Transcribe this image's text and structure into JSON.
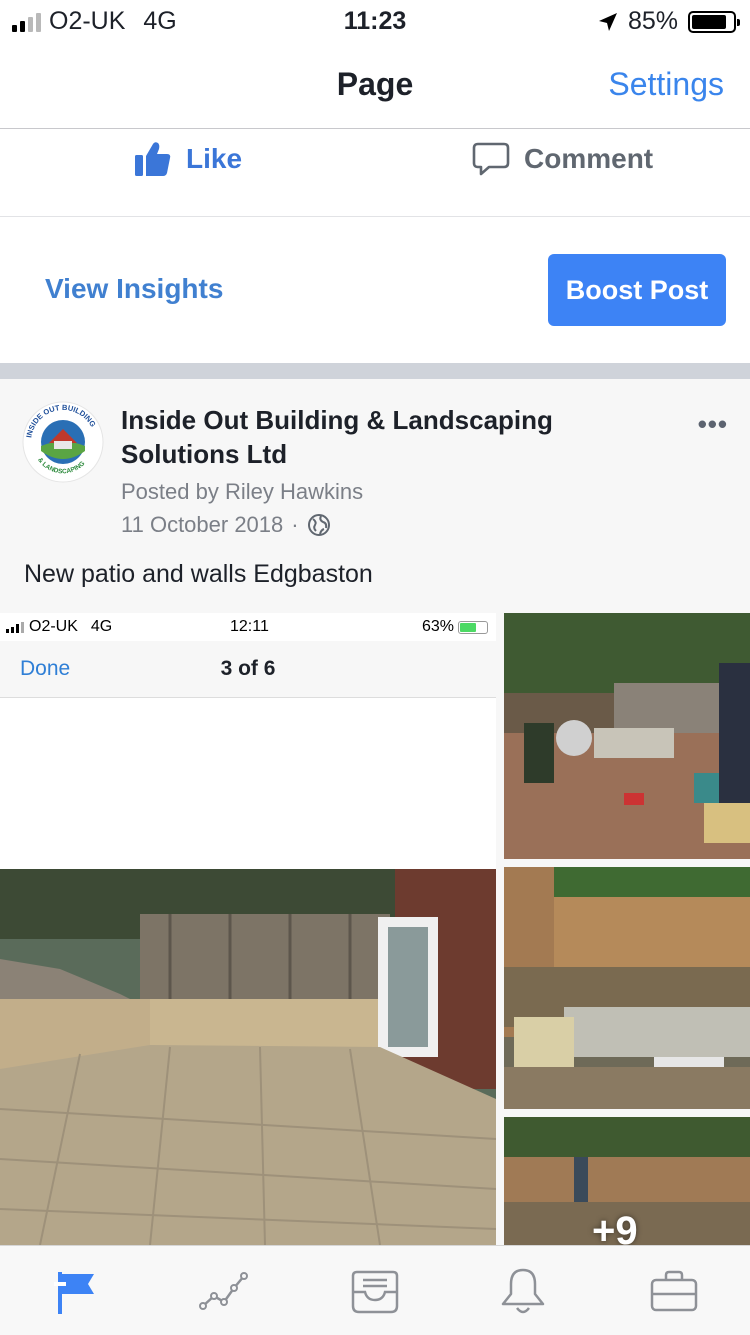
{
  "status_bar": {
    "carrier": "O2-UK",
    "network": "4G",
    "time": "11:23",
    "battery": "85%",
    "battery_level": 0.85
  },
  "nav": {
    "title": "Page",
    "settings_label": "Settings"
  },
  "actions": {
    "like_label": "Like",
    "comment_label": "Comment"
  },
  "insights": {
    "view_insights_label": "View Insights",
    "boost_label": "Boost Post"
  },
  "post": {
    "page_name": "Inside Out Building & Landscaping Solutions Ltd",
    "posted_by": "Posted by Riley Hawkins",
    "date": "11 October 2018",
    "date_separator": "·",
    "more_label": "•••",
    "logo_text_top": "INSIDE OUT BUILDING",
    "logo_text_bottom": "& LANDSCAPING",
    "caption": "New patio and walls Edgbaston",
    "photo_overlay": "+9"
  },
  "embedded_screenshot": {
    "carrier": "O2-UK",
    "network": "4G",
    "time": "12:11",
    "battery": "63%",
    "battery_level": 0.63,
    "done_label": "Done",
    "counter": "3 of 6"
  },
  "tabs": [
    {
      "name": "page-icon",
      "active": true
    },
    {
      "name": "insights-icon",
      "active": false
    },
    {
      "name": "inbox-icon",
      "active": false
    },
    {
      "name": "notifications-icon",
      "active": false
    },
    {
      "name": "tools-icon",
      "active": false
    }
  ],
  "colors": {
    "accent": "#3d83f5",
    "like_blue": "#3b76d8",
    "divider": "#cfd3da"
  }
}
